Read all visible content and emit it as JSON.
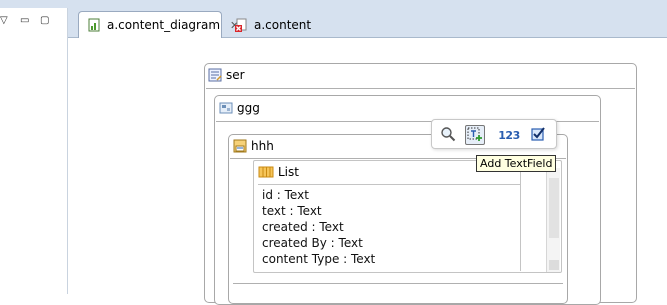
{
  "tabs": [
    {
      "label": "a.content_diagram",
      "icon": "diagram-file-icon",
      "active": true
    },
    {
      "label": "a.content",
      "icon": "content-file-error-icon",
      "active": false
    }
  ],
  "diagram": {
    "ser": {
      "label": "ser"
    },
    "ggg": {
      "label": "ggg"
    },
    "hhh": {
      "label": "hhh"
    },
    "list": {
      "label": "List",
      "fields": [
        "id : Text",
        "text : Text",
        "created : Text",
        "created By : Text",
        "content Type : Text"
      ]
    }
  },
  "palette": {
    "buttons": [
      {
        "name": "zoom-icon"
      },
      {
        "name": "add-textfield-icon",
        "selected": true
      },
      {
        "name": "number-field-icon",
        "label": "123"
      },
      {
        "name": "checkbox-icon"
      }
    ],
    "tooltip": "Add TextField"
  },
  "colors": {
    "tabbar": "#d6e1ef",
    "tooltip_bg": "#ffffe1",
    "border": "#a8a8a8"
  }
}
